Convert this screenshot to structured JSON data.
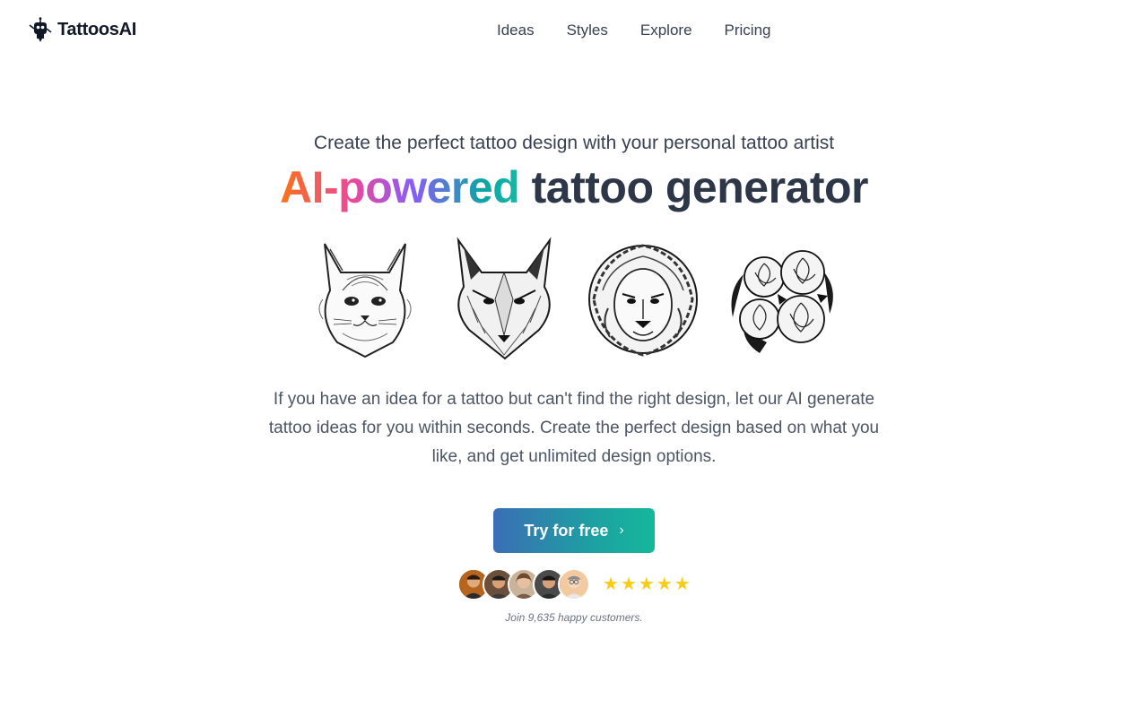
{
  "brand": {
    "name": "TattoosAI",
    "icon": "robot-pen-icon"
  },
  "nav": {
    "links": [
      "Ideas",
      "Styles",
      "Explore",
      "Pricing"
    ]
  },
  "hero": {
    "subtitle": "Create the perfect tattoo design with your personal tattoo artist",
    "headline_gradient": "AI-powered",
    "headline_rest": " tattoo generator",
    "gradient_colors": [
      "#f97316",
      "#ec4899",
      "#8b5cf6",
      "#14b8a6"
    ],
    "examples": [
      "cat",
      "wolf",
      "lion",
      "roses"
    ],
    "description": "If you have an idea for a tattoo but can't find the right design, let our AI generate tattoo ideas for you within seconds. Create the perfect design based on what you like, and get unlimited design options.",
    "cta_label": "Try for free",
    "cta_icon": "chevron-right-icon"
  },
  "social_proof": {
    "rating_stars": 5,
    "star_color": "#facc15",
    "text": "Join 9,635 happy customers."
  }
}
